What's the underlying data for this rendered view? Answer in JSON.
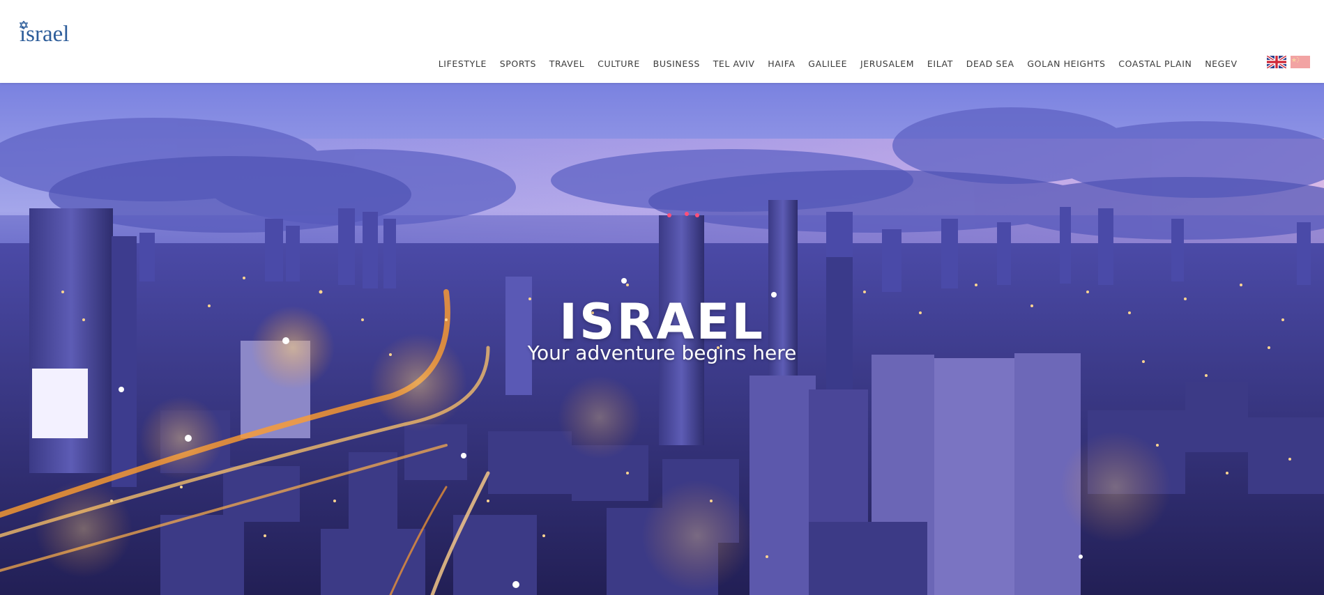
{
  "header": {
    "logo_text": "israel",
    "logo_icon": "star-of-david-icon",
    "nav": [
      {
        "label": "LIFESTYLE"
      },
      {
        "label": "SPORTS"
      },
      {
        "label": "TRAVEL"
      },
      {
        "label": "CULTURE"
      },
      {
        "label": "BUSINESS"
      },
      {
        "label": "TEL AVIV"
      },
      {
        "label": "HAIFA"
      },
      {
        "label": "GALILEE"
      },
      {
        "label": "JERUSALEM"
      },
      {
        "label": "EILAT"
      },
      {
        "label": "DEAD SEA"
      },
      {
        "label": "GOLAN HEIGHTS"
      },
      {
        "label": "COASTAL PLAIN"
      },
      {
        "label": "NEGEV"
      }
    ],
    "languages": [
      {
        "icon": "uk-flag-icon"
      },
      {
        "icon": "china-flag-icon"
      }
    ]
  },
  "hero": {
    "title": "ISRAEL",
    "subtitle": "Your adventure begins here"
  },
  "colors": {
    "logo": "#2d5d9a",
    "nav_text": "#3a3a3a",
    "sky_top": "#6f78d8",
    "sky_bottom": "#3a3c8f",
    "city_lights": "#ffb04a"
  }
}
